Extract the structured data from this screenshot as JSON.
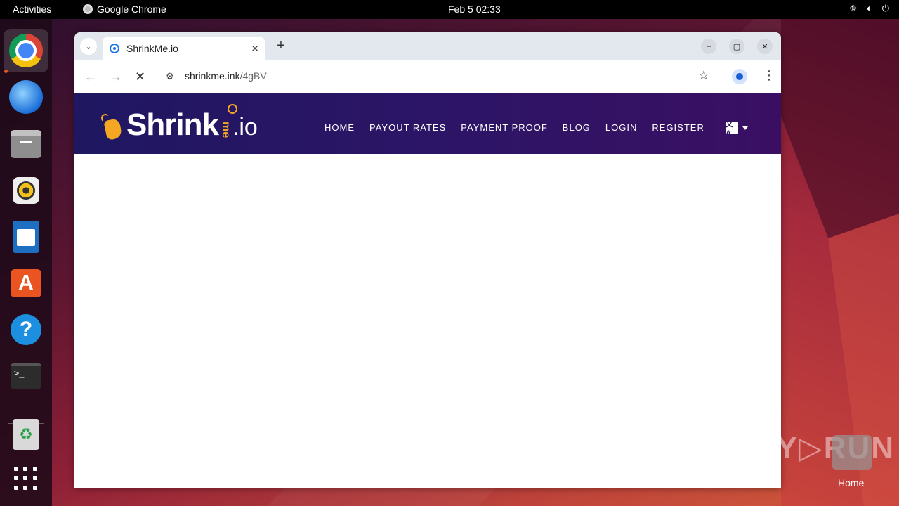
{
  "topbar": {
    "activities": "Activities",
    "app_name": "Google Chrome",
    "clock": "Feb 5  02:33"
  },
  "dock": {
    "items": [
      "chrome",
      "thunderbird",
      "files",
      "rhythmbox",
      "libreoffice-writer",
      "app-center",
      "help",
      "terminal",
      "trash",
      "show-apps"
    ]
  },
  "browser": {
    "tab_title": "ShrinkMe.io",
    "url_host": "shrinkme.ink",
    "url_path": "/4gBV"
  },
  "site": {
    "logo_main": "Shrink",
    "logo_me": "me",
    "logo_io": ".io",
    "nav": [
      "HOME",
      "PAYOUT RATES",
      "PAYMENT PROOF",
      "BLOG",
      "LOGIN",
      "REGISTER"
    ],
    "lang_icon": "文A"
  },
  "desktop": {
    "watermark": "ANY▷RUN",
    "home_label": "Home"
  },
  "colors": {
    "header_start": "#1f1761",
    "header_end": "#3a0f63",
    "logo_accent": "#f5a623"
  }
}
